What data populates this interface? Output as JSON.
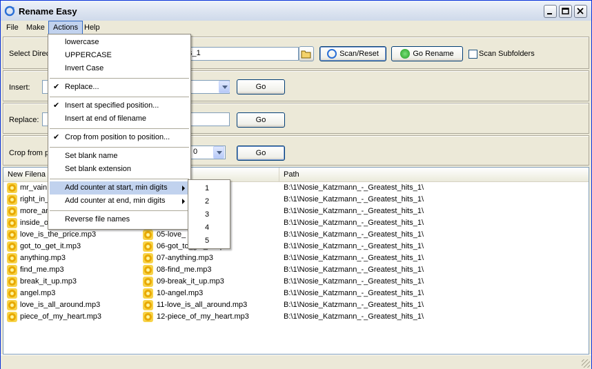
{
  "window": {
    "title": "Rename Easy"
  },
  "menubar": [
    "File",
    "Make",
    "Actions",
    "Help"
  ],
  "select_dir": {
    "label": "Select Direc",
    "value": "ts_1",
    "scan_label": "Scan/Reset",
    "go_rename_label": "Go Rename",
    "subfolders_label": "Scan Subfolders"
  },
  "insert": {
    "label": "Insert:",
    "go_label": "Go"
  },
  "replace": {
    "label": "Replace:",
    "go_label": "Go"
  },
  "crop": {
    "label": "Crop from po",
    "value": "0",
    "go_label": "Go"
  },
  "list": {
    "columns": [
      "New Filena",
      "Path"
    ],
    "rows": [
      {
        "new": "mr_vain.",
        "old": "",
        "path": "B:\\1\\Nosie_Katzmann_-_Greatest_hits_1\\"
      },
      {
        "new": "right_in_",
        "old": "mp3",
        "path": "B:\\1\\Nosie_Katzmann_-_Greatest_hits_1\\"
      },
      {
        "new": "more_an",
        "old": "mp3",
        "path": "B:\\1\\Nosie_Katzmann_-_Greatest_hits_1\\"
      },
      {
        "new": "inside_o",
        "old": "",
        "path": "B:\\1\\Nosie_Katzmann_-_Greatest_hits_1\\"
      },
      {
        "new": "love_is_the_price.mp3",
        "old": "05-love_",
        "path": "B:\\1\\Nosie_Katzmann_-_Greatest_hits_1\\"
      },
      {
        "new": "got_to_get_it.mp3",
        "old": "06-got_to_get_it.mp3",
        "path": "B:\\1\\Nosie_Katzmann_-_Greatest_hits_1\\"
      },
      {
        "new": "anything.mp3",
        "old": "07-anything.mp3",
        "path": "B:\\1\\Nosie_Katzmann_-_Greatest_hits_1\\"
      },
      {
        "new": "find_me.mp3",
        "old": "08-find_me.mp3",
        "path": "B:\\1\\Nosie_Katzmann_-_Greatest_hits_1\\"
      },
      {
        "new": "break_it_up.mp3",
        "old": "09-break_it_up.mp3",
        "path": "B:\\1\\Nosie_Katzmann_-_Greatest_hits_1\\"
      },
      {
        "new": "angel.mp3",
        "old": "10-angel.mp3",
        "path": "B:\\1\\Nosie_Katzmann_-_Greatest_hits_1\\"
      },
      {
        "new": "love_is_all_around.mp3",
        "old": "11-love_is_all_around.mp3",
        "path": "B:\\1\\Nosie_Katzmann_-_Greatest_hits_1\\"
      },
      {
        "new": "piece_of_my_heart.mp3",
        "old": "12-piece_of_my_heart.mp3",
        "path": "B:\\1\\Nosie_Katzmann_-_Greatest_hits_1\\"
      }
    ]
  },
  "actions_menu": [
    {
      "label": "lowercase",
      "checked": false
    },
    {
      "label": "UPPERCASE",
      "checked": false
    },
    {
      "label": "Invert Case",
      "checked": false
    },
    {
      "label": "Replace...",
      "checked": true
    },
    {
      "label": "Insert at specified position...",
      "checked": true
    },
    {
      "label": "Insert at end of filename",
      "checked": false
    },
    {
      "label": "Crop from position to position...",
      "checked": true
    },
    {
      "label": "Set blank name",
      "checked": false
    },
    {
      "label": "Set blank extension",
      "checked": false
    },
    {
      "label": "Add counter at start, min digits",
      "checked": false,
      "submenu": true,
      "highlighted": true
    },
    {
      "label": "Add counter at end, min digits",
      "checked": false,
      "submenu": true
    },
    {
      "label": "Reverse file names",
      "checked": false
    }
  ],
  "counter_submenu": [
    "1",
    "2",
    "3",
    "4",
    "5"
  ],
  "icons": {
    "app": "rename-refresh-icon",
    "file": "mp3-file-icon",
    "folder": "folder-open-icon",
    "scan": "refresh-icon",
    "go": "green-arrow-icon"
  },
  "colors": {
    "titlebar": "#dfe6f2",
    "highlight": "#c1d2ee",
    "window_bg": "#ece9d8"
  }
}
